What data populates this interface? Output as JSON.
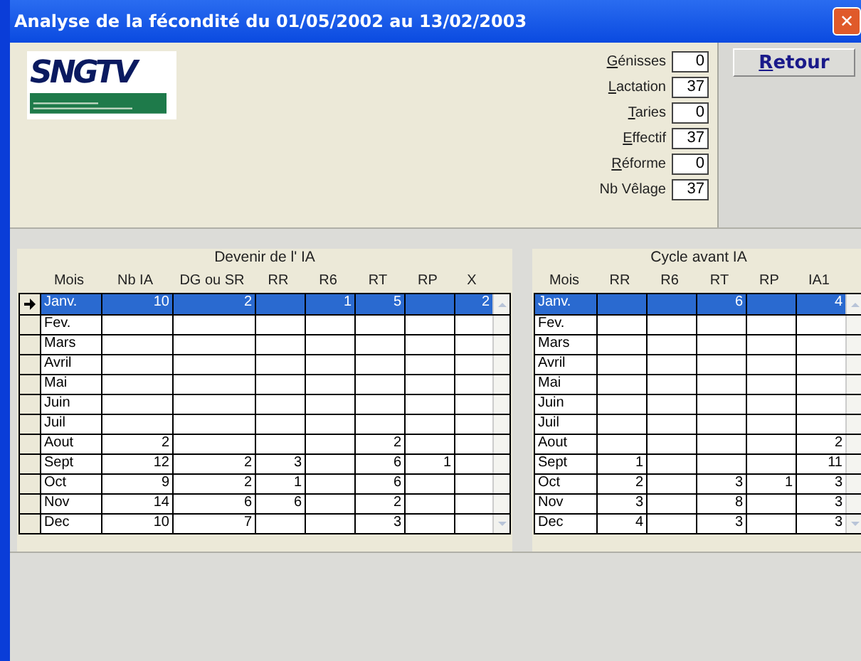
{
  "window": {
    "title": "Analyse de la fécondité du 01/05/2002 au 13/02/2003",
    "close": "✕"
  },
  "logo": {
    "text": "SNGTV"
  },
  "counts": [
    {
      "label": "Génisses",
      "underline_first": true,
      "value": "0"
    },
    {
      "label": "Lactation",
      "underline_first": true,
      "value": "37"
    },
    {
      "label": "Taries",
      "underline_first": true,
      "value": "0"
    },
    {
      "label": "Effectif",
      "underline_first": true,
      "value": "37"
    },
    {
      "label": "Réforme",
      "underline_first": true,
      "value": "0"
    },
    {
      "label": "Nb Vêlage",
      "underline_first": false,
      "value": "37"
    }
  ],
  "retour_button": {
    "label": "Retour",
    "underline_first": true
  },
  "tables": [
    {
      "group_title": "Devenir de l' IA",
      "row_selector": true,
      "columns": [
        "Mois",
        "Nb IA",
        "DG ou SR",
        "RR",
        "R6",
        "RT",
        "RP",
        "X"
      ],
      "rows": [
        {
          "selected": true,
          "cells": [
            "Janv.",
            "10",
            "2",
            "",
            "1",
            "5",
            "",
            "2"
          ]
        },
        {
          "selected": false,
          "cells": [
            "Fev.",
            "",
            "",
            "",
            "",
            "",
            "",
            ""
          ]
        },
        {
          "selected": false,
          "cells": [
            "Mars",
            "",
            "",
            "",
            "",
            "",
            "",
            ""
          ]
        },
        {
          "selected": false,
          "cells": [
            "Avril",
            "",
            "",
            "",
            "",
            "",
            "",
            ""
          ]
        },
        {
          "selected": false,
          "cells": [
            "Mai",
            "",
            "",
            "",
            "",
            "",
            "",
            ""
          ]
        },
        {
          "selected": false,
          "cells": [
            "Juin",
            "",
            "",
            "",
            "",
            "",
            "",
            ""
          ]
        },
        {
          "selected": false,
          "cells": [
            "Juil",
            "",
            "",
            "",
            "",
            "",
            "",
            ""
          ]
        },
        {
          "selected": false,
          "cells": [
            "Aout",
            "2",
            "",
            "",
            "",
            "2",
            "",
            ""
          ]
        },
        {
          "selected": false,
          "cells": [
            "Sept",
            "12",
            "2",
            "3",
            "",
            "6",
            "1",
            ""
          ]
        },
        {
          "selected": false,
          "cells": [
            "Oct",
            "9",
            "2",
            "1",
            "",
            "6",
            "",
            ""
          ]
        },
        {
          "selected": false,
          "cells": [
            "Nov",
            "14",
            "6",
            "6",
            "",
            "2",
            "",
            ""
          ]
        },
        {
          "selected": false,
          "cells": [
            "Dec",
            "10",
            "7",
            "",
            "",
            "3",
            "",
            ""
          ]
        }
      ]
    },
    {
      "group_title": "Cycle avant IA",
      "row_selector": false,
      "columns": [
        "Mois",
        "RR",
        "R6",
        "RT",
        "RP",
        "IA1"
      ],
      "rows": [
        {
          "selected": true,
          "cells": [
            "Janv.",
            "",
            "",
            "6",
            "",
            "4"
          ]
        },
        {
          "selected": false,
          "cells": [
            "Fev.",
            "",
            "",
            "",
            "",
            ""
          ]
        },
        {
          "selected": false,
          "cells": [
            "Mars",
            "",
            "",
            "",
            "",
            ""
          ]
        },
        {
          "selected": false,
          "cells": [
            "Avril",
            "",
            "",
            "",
            "",
            ""
          ]
        },
        {
          "selected": false,
          "cells": [
            "Mai",
            "",
            "",
            "",
            "",
            ""
          ]
        },
        {
          "selected": false,
          "cells": [
            "Juin",
            "",
            "",
            "",
            "",
            ""
          ]
        },
        {
          "selected": false,
          "cells": [
            "Juil",
            "",
            "",
            "",
            "",
            ""
          ]
        },
        {
          "selected": false,
          "cells": [
            "Aout",
            "",
            "",
            "",
            "",
            "2"
          ]
        },
        {
          "selected": false,
          "cells": [
            "Sept",
            "1",
            "",
            "",
            "",
            "11"
          ]
        },
        {
          "selected": false,
          "cells": [
            "Oct",
            "2",
            "",
            "3",
            "1",
            "3"
          ]
        },
        {
          "selected": false,
          "cells": [
            "Nov",
            "3",
            "",
            "8",
            "",
            "3"
          ]
        },
        {
          "selected": false,
          "cells": [
            "Dec",
            "4",
            "",
            "3",
            "",
            "3"
          ]
        }
      ]
    }
  ]
}
